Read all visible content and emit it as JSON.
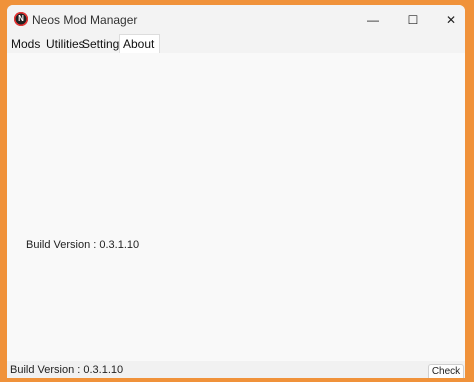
{
  "window": {
    "title": "Neos Mod Manager",
    "icon": "neos-app-icon",
    "controls": {
      "minimize": "—",
      "maximize": "☐",
      "close": "✕"
    }
  },
  "menu": {
    "tabs": [
      {
        "label": "Mods"
      },
      {
        "label": "Utilities"
      },
      {
        "label": "Settings"
      },
      {
        "label": "About"
      }
    ],
    "selected": "About"
  },
  "about": {
    "build_version": "Build Version : 0.3.1.10"
  },
  "status_bar": {
    "build_version": "Build Version : 0.3.1.10",
    "check_label": "Check"
  },
  "colors": {
    "desktop": "#f0923a",
    "window_bg": "#f9f9f9",
    "titlebar_bg": "#f3f3f3"
  }
}
